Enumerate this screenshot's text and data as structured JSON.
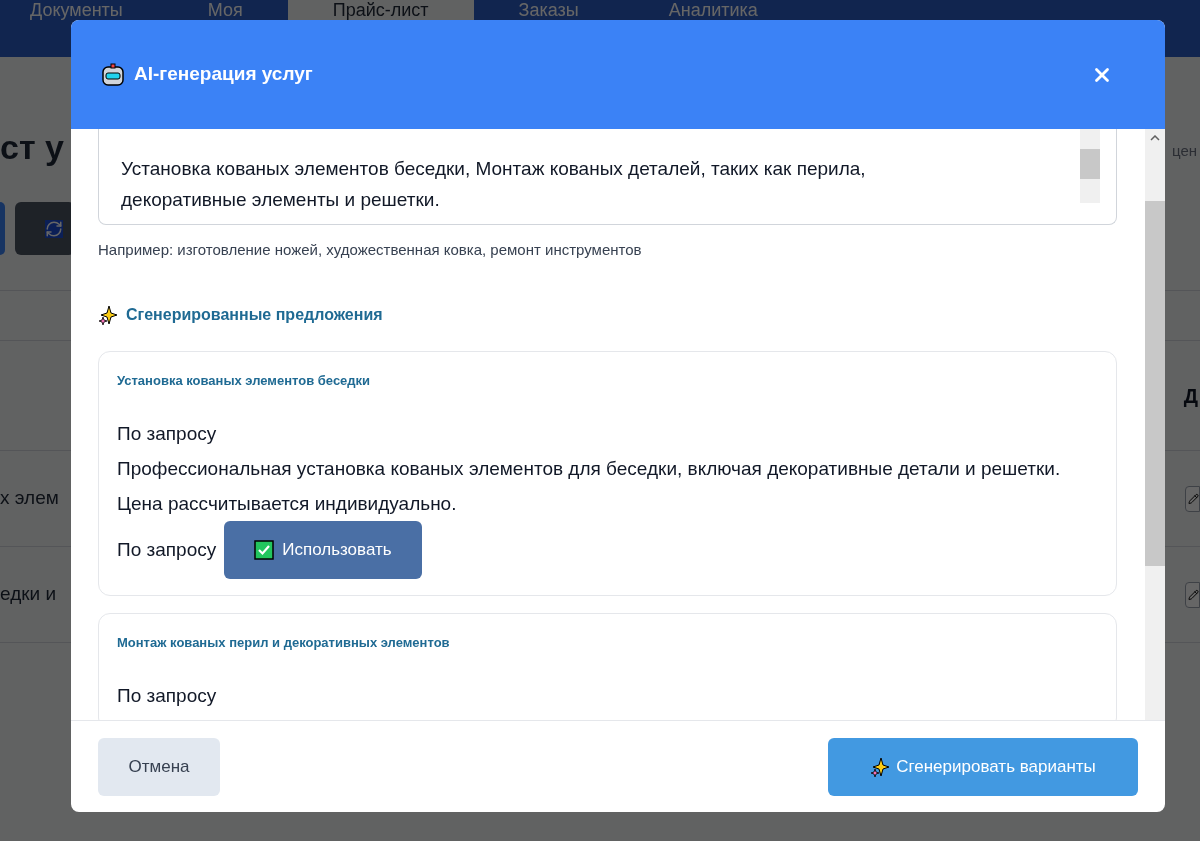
{
  "background": {
    "nav": [
      {
        "label": "Документы",
        "selected": false
      },
      {
        "label": "Моя",
        "selected": false
      },
      {
        "label": "Прайс-лист",
        "selected": true
      },
      {
        "label": "Заказы",
        "selected": false
      },
      {
        "label": "Аналитика",
        "selected": false
      }
    ],
    "page_title": "ст у",
    "side_text": "цен",
    "column_heading": "Д",
    "rows": [
      "х элем",
      "едки и"
    ]
  },
  "modal": {
    "title": "AI-генерация услуг",
    "description_value": "Установка кованых элементов беседки, Монтаж кованых деталей, таких как перила, декоративные элементы и решетки.",
    "hint": "Например: изготовление ножей, художественная ковка, ремонт инструментов",
    "section_title": "Сгенерированные предложения",
    "suggestions": [
      {
        "title": "Установка кованых элементов беседки",
        "price": "По запросу",
        "description": "Профессиональная установка кованых элементов для беседки, включая декоративные детали и решетки. Цена рассчитывается индивидуально.",
        "footer_price": "По запросу",
        "action": "Использовать"
      },
      {
        "title": "Монтаж кованых перил и декоративных элементов",
        "price": "По запросу"
      }
    ],
    "cancel": "Отмена",
    "generate": "Сгенерировать варианты"
  }
}
